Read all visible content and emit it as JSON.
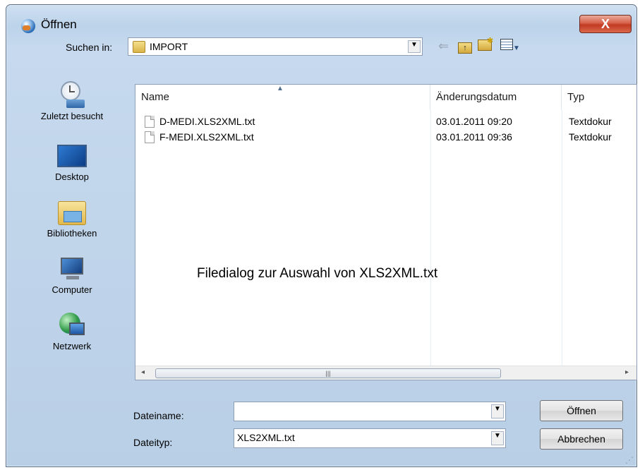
{
  "window": {
    "title": "Öffnen",
    "close_label": "X"
  },
  "location": {
    "label": "Suchen in:",
    "folder": "IMPORT"
  },
  "toolbar": {
    "back_icon": "back-arrow-icon",
    "up_icon": "up-folder-icon",
    "new_folder_icon": "new-folder-icon",
    "views_icon": "view-menu-icon"
  },
  "places": [
    {
      "label": "Zuletzt besucht",
      "icon": "recent-places-icon"
    },
    {
      "label": "Desktop",
      "icon": "desktop-icon"
    },
    {
      "label": "Bibliotheken",
      "icon": "libraries-icon"
    },
    {
      "label": "Computer",
      "icon": "computer-icon"
    },
    {
      "label": "Netzwerk",
      "icon": "network-icon"
    }
  ],
  "columns": {
    "name": "Name",
    "date": "Änderungsdatum",
    "type": "Typ"
  },
  "files": [
    {
      "name": "D-MEDI.XLS2XML.txt",
      "date": "03.01.2011 09:20",
      "type": "Textdokur"
    },
    {
      "name": "F-MEDI.XLS2XML.txt",
      "date": "03.01.2011 09:36",
      "type": "Textdokur"
    }
  ],
  "caption": "Filedialog zur Auswahl von XLS2XML.txt",
  "filename": {
    "label": "Dateiname:",
    "value": ""
  },
  "filetype": {
    "label": "Dateityp:",
    "value": "XLS2XML.txt"
  },
  "buttons": {
    "open": "Öffnen",
    "cancel": "Abbrechen"
  }
}
